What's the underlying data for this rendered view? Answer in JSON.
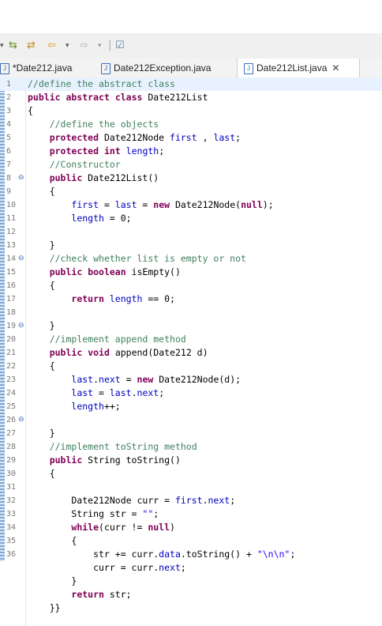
{
  "toolbar": {
    "icons": [
      "dropdown-arrow",
      "next-annotation-icon",
      "prev-annotation-icon",
      "back-icon",
      "dropdown-arrow",
      "forward-icon",
      "dropdown-arrow",
      "separator",
      "open-task-icon"
    ]
  },
  "tabs": [
    {
      "label": "*Date212.java",
      "active": false
    },
    {
      "label": "Date212Exception.java",
      "active": false
    },
    {
      "label": "Date212List.java",
      "active": true
    }
  ],
  "editor": {
    "highlight_line": 1,
    "lines": [
      {
        "n": "1",
        "fold": "",
        "tokens": [
          [
            "c",
            "//define the abstract class"
          ]
        ]
      },
      {
        "n": "2",
        "fold": "",
        "tokens": [
          [
            "k",
            "public"
          ],
          [
            "",
            " "
          ],
          [
            "k",
            "abstract"
          ],
          [
            "",
            " "
          ],
          [
            "k",
            "class"
          ],
          [
            "",
            " Date212List"
          ]
        ]
      },
      {
        "n": "3",
        "fold": "",
        "tokens": [
          [
            "",
            "{"
          ]
        ]
      },
      {
        "n": "4",
        "fold": "",
        "tokens": [
          [
            "",
            "    "
          ],
          [
            "c",
            "//define the objects"
          ]
        ]
      },
      {
        "n": "5",
        "fold": "",
        "tokens": [
          [
            "",
            "    "
          ],
          [
            "k",
            "protected"
          ],
          [
            "",
            " Date212Node "
          ],
          [
            "f",
            "first"
          ],
          [
            "",
            " , "
          ],
          [
            "f",
            "last"
          ],
          [
            "",
            ";"
          ]
        ]
      },
      {
        "n": "6",
        "fold": "",
        "tokens": [
          [
            "",
            "    "
          ],
          [
            "k",
            "protected"
          ],
          [
            "",
            " "
          ],
          [
            "k",
            "int"
          ],
          [
            "",
            " "
          ],
          [
            "f",
            "length"
          ],
          [
            "",
            ";"
          ]
        ]
      },
      {
        "n": "7",
        "fold": "",
        "tokens": [
          [
            "",
            "    "
          ],
          [
            "c",
            "//Constructor"
          ]
        ]
      },
      {
        "n": "8",
        "fold": "⊖",
        "tokens": [
          [
            "",
            "    "
          ],
          [
            "k",
            "public"
          ],
          [
            "",
            " Date212List()"
          ]
        ]
      },
      {
        "n": "9",
        "fold": "",
        "tokens": [
          [
            "",
            "    {"
          ]
        ]
      },
      {
        "n": "10",
        "fold": "",
        "tokens": [
          [
            "",
            "        "
          ],
          [
            "f",
            "first"
          ],
          [
            "",
            " = "
          ],
          [
            "f",
            "last"
          ],
          [
            "",
            " = "
          ],
          [
            "k",
            "new"
          ],
          [
            "",
            " Date212Node("
          ],
          [
            "k",
            "null"
          ],
          [
            "",
            ");"
          ]
        ]
      },
      {
        "n": "11",
        "fold": "",
        "tokens": [
          [
            "",
            "        "
          ],
          [
            "f",
            "length"
          ],
          [
            "",
            " = 0;"
          ]
        ]
      },
      {
        "n": "12",
        "fold": "",
        "tokens": [
          [
            "",
            ""
          ]
        ]
      },
      {
        "n": "13",
        "fold": "",
        "tokens": [
          [
            "",
            "    }"
          ]
        ]
      },
      {
        "n": "14",
        "fold": "⊖",
        "tokens": [
          [
            "",
            "    "
          ],
          [
            "c",
            "//check whether list is empty or not"
          ]
        ]
      },
      {
        "n": "15",
        "fold": "",
        "tokens": [
          [
            "",
            "    "
          ],
          [
            "k",
            "public"
          ],
          [
            "",
            " "
          ],
          [
            "k",
            "boolean"
          ],
          [
            "",
            " isEmpty()"
          ]
        ]
      },
      {
        "n": "16",
        "fold": "",
        "tokens": [
          [
            "",
            "    {"
          ]
        ]
      },
      {
        "n": "17",
        "fold": "",
        "tokens": [
          [
            "",
            "        "
          ],
          [
            "k",
            "return"
          ],
          [
            "",
            " "
          ],
          [
            "f",
            "length"
          ],
          [
            "",
            " == 0;"
          ]
        ]
      },
      {
        "n": "18",
        "fold": "",
        "tokens": [
          [
            "",
            ""
          ]
        ]
      },
      {
        "n": "19",
        "fold": "⊖",
        "tokens": [
          [
            "",
            "    }"
          ]
        ]
      },
      {
        "n": "20",
        "fold": "",
        "tokens": [
          [
            "",
            "    "
          ],
          [
            "c",
            "//implement append method"
          ]
        ]
      },
      {
        "n": "21",
        "fold": "",
        "tokens": [
          [
            "",
            "    "
          ],
          [
            "k",
            "public"
          ],
          [
            "",
            " "
          ],
          [
            "k",
            "void"
          ],
          [
            "",
            " append(Date212 d)"
          ]
        ]
      },
      {
        "n": "22",
        "fold": "",
        "tokens": [
          [
            "",
            "    {"
          ]
        ]
      },
      {
        "n": "23",
        "fold": "",
        "tokens": [
          [
            "",
            "        "
          ],
          [
            "f",
            "last"
          ],
          [
            "",
            "."
          ],
          [
            "f",
            "next"
          ],
          [
            "",
            " = "
          ],
          [
            "k",
            "new"
          ],
          [
            "",
            " Date212Node(d);"
          ]
        ]
      },
      {
        "n": "24",
        "fold": "",
        "tokens": [
          [
            "",
            "        "
          ],
          [
            "f",
            "last"
          ],
          [
            "",
            " = "
          ],
          [
            "f",
            "last"
          ],
          [
            "",
            "."
          ],
          [
            "f",
            "next"
          ],
          [
            "",
            ";"
          ]
        ]
      },
      {
        "n": "25",
        "fold": "",
        "tokens": [
          [
            "",
            "        "
          ],
          [
            "f",
            "length"
          ],
          [
            "",
            "++;"
          ]
        ]
      },
      {
        "n": "26",
        "fold": "⊖",
        "tokens": [
          [
            "",
            ""
          ]
        ]
      },
      {
        "n": "27",
        "fold": "",
        "tokens": [
          [
            "",
            "    }"
          ]
        ]
      },
      {
        "n": "28",
        "fold": "",
        "tokens": [
          [
            "",
            "    "
          ],
          [
            "c",
            "//implement toString method"
          ]
        ]
      },
      {
        "n": "29",
        "fold": "",
        "tokens": [
          [
            "",
            "    "
          ],
          [
            "k",
            "public"
          ],
          [
            "",
            " String toString()"
          ]
        ]
      },
      {
        "n": "30",
        "fold": "",
        "tokens": [
          [
            "",
            "    {"
          ]
        ]
      },
      {
        "n": "31",
        "fold": "",
        "tokens": [
          [
            "",
            ""
          ]
        ]
      },
      {
        "n": "32",
        "fold": "",
        "tokens": [
          [
            "",
            "        Date212Node curr = "
          ],
          [
            "f",
            "first"
          ],
          [
            "",
            "."
          ],
          [
            "f",
            "next"
          ],
          [
            "",
            ";"
          ]
        ]
      },
      {
        "n": "33",
        "fold": "",
        "tokens": [
          [
            "",
            "        String str = "
          ],
          [
            "s",
            "\"\""
          ],
          [
            "",
            ";"
          ]
        ]
      },
      {
        "n": "34",
        "fold": "",
        "tokens": [
          [
            "",
            "        "
          ],
          [
            "k",
            "while"
          ],
          [
            "",
            "(curr != "
          ],
          [
            "k",
            "null"
          ],
          [
            "",
            ")"
          ]
        ]
      },
      {
        "n": "35",
        "fold": "",
        "tokens": [
          [
            "",
            "        {"
          ]
        ]
      },
      {
        "n": "36",
        "fold": "",
        "tokens": [
          [
            "",
            "            str += curr."
          ],
          [
            "f",
            "data"
          ],
          [
            "",
            ".toString() + "
          ],
          [
            "s",
            "\"\\n\\n\""
          ],
          [
            "",
            ";"
          ]
        ]
      },
      {
        "n": "",
        "fold": "",
        "tokens": [
          [
            "",
            "            curr = curr."
          ],
          [
            "f",
            "next"
          ],
          [
            "",
            ";"
          ]
        ]
      },
      {
        "n": "",
        "fold": "",
        "tokens": [
          [
            "",
            "        }"
          ]
        ]
      },
      {
        "n": "",
        "fold": "",
        "tokens": [
          [
            "",
            "        "
          ],
          [
            "k",
            "return"
          ],
          [
            "",
            " str;"
          ]
        ]
      },
      {
        "n": "",
        "fold": "",
        "tokens": [
          [
            "",
            "    }}"
          ]
        ]
      }
    ]
  }
}
